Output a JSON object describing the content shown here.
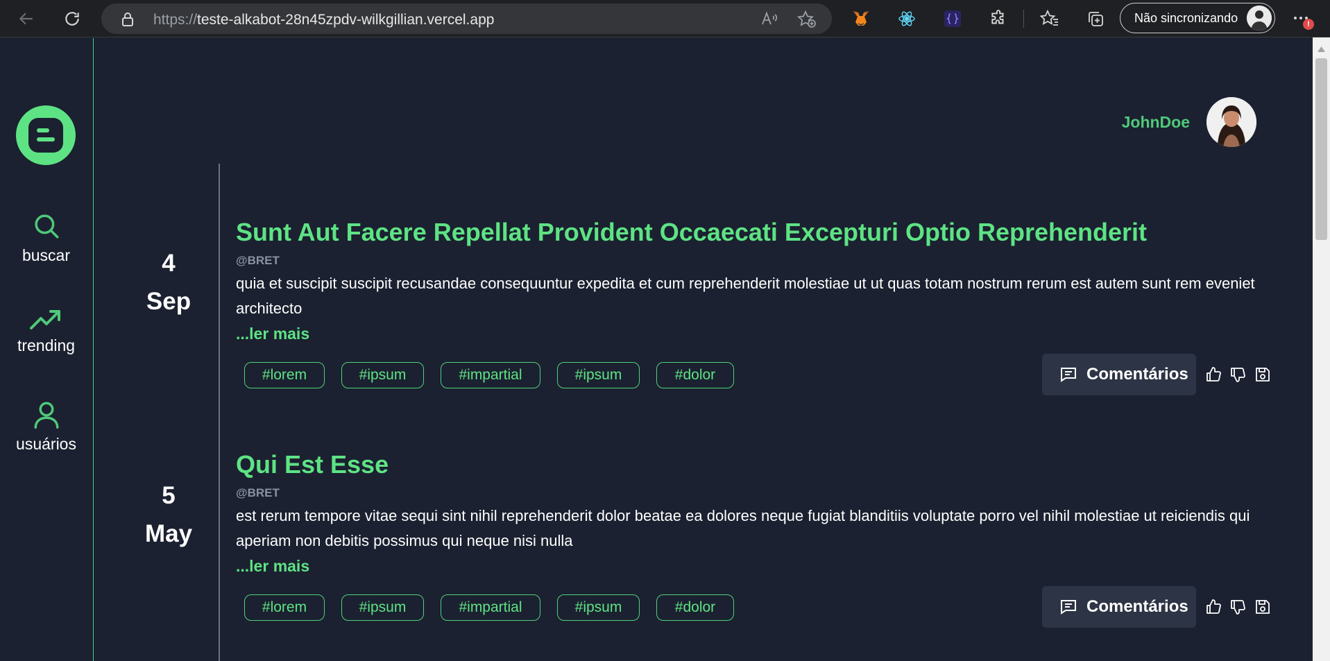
{
  "browser": {
    "url_protocol": "https://",
    "url_host": "teste-alkabot-28n45zpdv-wilkgillian.vercel.app",
    "profile_label": "Não sincronizando",
    "notification_badge": "!"
  },
  "sidebar": {
    "logo_icon": "blogger-icon",
    "items": [
      {
        "label": "buscar",
        "icon": "search-icon"
      },
      {
        "label": "trending",
        "icon": "trending-up-icon"
      },
      {
        "label": "usuários",
        "icon": "user-icon"
      }
    ]
  },
  "header": {
    "username": "JohnDoe"
  },
  "colors": {
    "accent": "#5ee384",
    "background": "#1b2130",
    "button_bg": "#2d3445",
    "author": "#8a92a3"
  },
  "posts": [
    {
      "day": "4",
      "month": "Sep",
      "title": "Sunt Aut Facere Repellat Provident Occaecati Excepturi Optio Reprehenderit",
      "author": "@BRET",
      "body": "quia et suscipit suscipit recusandae consequuntur expedita et cum reprehenderit molestiae ut ut quas totam nostrum rerum est autem sunt rem eveniet architecto",
      "read_more": "...ler mais",
      "tags": [
        "#lorem",
        "#ipsum",
        "#impartial",
        "#ipsum",
        "#dolor"
      ],
      "comments_label": "Comentários"
    },
    {
      "day": "5",
      "month": "May",
      "title": "Qui Est Esse",
      "author": "@BRET",
      "body": "est rerum tempore vitae sequi sint nihil reprehenderit dolor beatae ea dolores neque fugiat blanditiis voluptate porro vel nihil molestiae ut reiciendis qui aperiam non debitis possimus qui neque nisi nulla",
      "read_more": "...ler mais",
      "tags": [
        "#lorem",
        "#ipsum",
        "#impartial",
        "#ipsum",
        "#dolor"
      ],
      "comments_label": "Comentários"
    }
  ]
}
